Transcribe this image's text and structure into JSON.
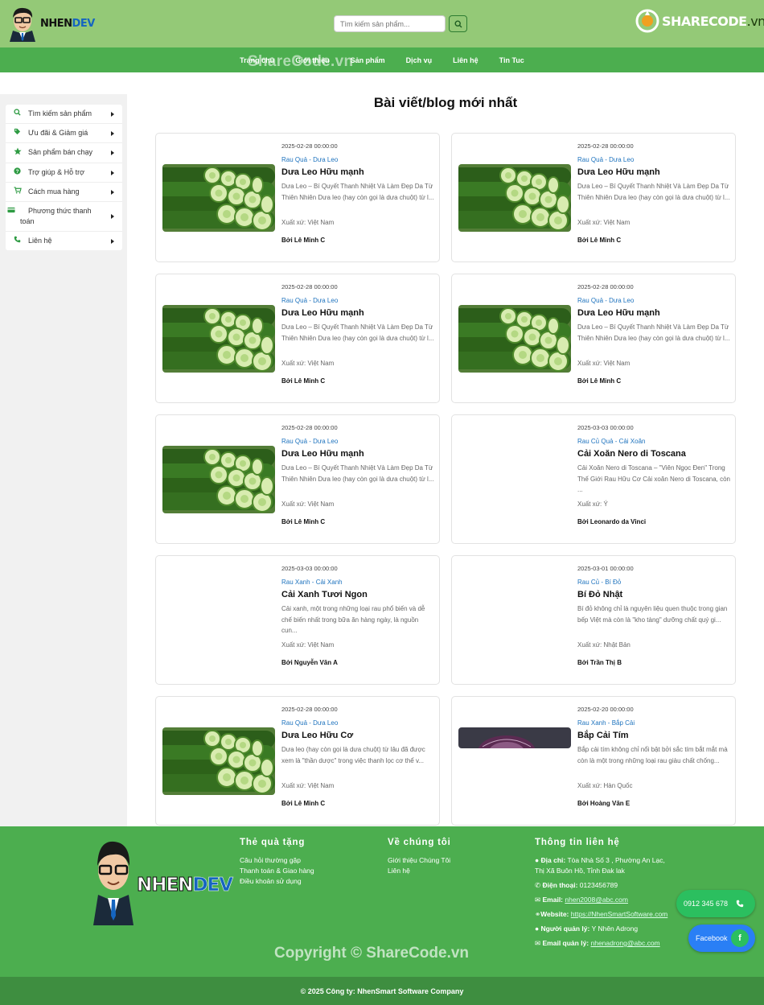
{
  "header": {
    "logo_text_a": "NHEN",
    "logo_text_b": "DEV",
    "search_placeholder": "Tìm kiếm sản phẩm...",
    "sharecode_main": "SHARECODE",
    "sharecode_domain": ".vn"
  },
  "nav": {
    "items": [
      "Trang chủ",
      "Giới thiệu",
      "Sản phẩm",
      "Dịch vụ",
      "Liên hệ",
      "Tin Tuc"
    ],
    "watermark": "ShareCode.vn"
  },
  "sidebar": {
    "items": [
      {
        "label": "Tìm kiếm sản phẩm",
        "icon": "search-icon"
      },
      {
        "label": "Ưu đãi & Giảm giá",
        "icon": "tag-icon"
      },
      {
        "label": "Sản phẩm bán chạy",
        "icon": "star-icon"
      },
      {
        "label": "Trợ giúp & Hỗ trợ",
        "icon": "question-icon"
      },
      {
        "label": "Cách mua hàng",
        "icon": "cart-icon"
      },
      {
        "label": "Phương thức thanh toán",
        "icon": "credit-card-icon"
      },
      {
        "label": "Liên hệ",
        "icon": "phone-icon"
      }
    ]
  },
  "main": {
    "title": "Bài viết/blog mới nhất",
    "posts": [
      {
        "date": "2025-02-28 00:00:00",
        "category": "Rau Quả - Dưa Leo",
        "title": "Dưa Leo Hữu mạnh",
        "desc": "Dưa Leo – Bí Quyết Thanh Nhiệt Và Làm Đẹp Da Từ Thiên Nhiên Dưa leo (hay còn gọi là dưa chuột) từ l...",
        "origin": "Xuất xứ: Việt Nam",
        "author": "Bởi Lê Minh C",
        "image": "cucumber"
      },
      {
        "date": "2025-02-28 00:00:00",
        "category": "Rau Quả - Dưa Leo",
        "title": "Dưa Leo Hữu mạnh",
        "desc": "Dưa Leo – Bí Quyết Thanh Nhiệt Và Làm Đẹp Da Từ Thiên Nhiên Dưa leo (hay còn gọi là dưa chuột) từ l...",
        "origin": "Xuất xứ: Việt Nam",
        "author": "Bởi Lê Minh C",
        "image": "cucumber"
      },
      {
        "date": "2025-02-28 00:00:00",
        "category": "Rau Quả - Dưa Leo",
        "title": "Dưa Leo Hữu mạnh",
        "desc": "Dưa Leo – Bí Quyết Thanh Nhiệt Và Làm Đẹp Da Từ Thiên Nhiên Dưa leo (hay còn gọi là dưa chuột) từ l...",
        "origin": "Xuất xứ: Việt Nam",
        "author": "Bởi Lê Minh C",
        "image": "cucumber"
      },
      {
        "date": "2025-02-28 00:00:00",
        "category": "Rau Quả - Dưa Leo",
        "title": "Dưa Leo Hữu mạnh",
        "desc": "Dưa Leo – Bí Quyết Thanh Nhiệt Và Làm Đẹp Da Từ Thiên Nhiên Dưa leo (hay còn gọi là dưa chuột) từ l...",
        "origin": "Xuất xứ: Việt Nam",
        "author": "Bởi Lê Minh C",
        "image": "cucumber"
      },
      {
        "date": "2025-02-28 00:00:00",
        "category": "Rau Quả - Dưa Leo",
        "title": "Dưa Leo Hữu mạnh",
        "desc": "Dưa Leo – Bí Quyết Thanh Nhiệt Và Làm Đẹp Da Từ Thiên Nhiên Dưa leo (hay còn gọi là dưa chuột) từ l...",
        "origin": "Xuất xứ: Việt Nam",
        "author": "Bởi Lê Minh C",
        "image": "cucumber"
      },
      {
        "date": "2025-03-03 00:00:00",
        "category": "Rau Củ Quả - Cải Xoăn",
        "title": "Cải Xoăn Nero di Toscana",
        "desc": "Cải Xoăn Nero di Toscana – \"Viên Ngọc Đen\" Trong Thế Giới Rau Hữu Cơ Cải xoăn Nero di Toscana, còn ...",
        "origin": "Xuất xứ: Ý",
        "author": "Bởi Leonardo da Vinci",
        "image": "none"
      },
      {
        "date": "2025-03-03 00:00:00",
        "category": "Rau Xanh - Cải Xanh",
        "title": "Cải Xanh Tươi Ngon",
        "desc": "Cải xanh, một trong những loại rau phổ biến và dễ chế biến nhất trong bữa ăn hàng ngày, là nguồn cun...",
        "origin": "Xuất xứ: Việt Nam",
        "author": "Bởi Nguyễn Văn A",
        "image": "none"
      },
      {
        "date": "2025-03-01 00:00:00",
        "category": "Rau Củ - Bí Đỏ",
        "title": "Bí Đỏ Nhật",
        "desc": "Bí đỏ không chỉ là nguyên liệu quen thuộc trong gian bếp Việt mà còn là \"kho tàng\" dưỡng chất quý gi...",
        "origin": "Xuất xứ: Nhật Bản",
        "author": "Bởi Trần Thị B",
        "image": "none"
      },
      {
        "date": "2025-02-28 00:00:00",
        "category": "Rau Quả - Dưa Leo",
        "title": "Dưa Leo Hữu Cơ",
        "desc": "Dưa leo (hay còn gọi là dưa chuột) từ lâu đã được xem là \"thần dược\" trong việc thanh lọc cơ thể v...",
        "origin": "Xuất xứ: Việt Nam",
        "author": "Bởi Lê Minh C",
        "image": "cucumber"
      },
      {
        "date": "2025-02-20 00:00:00",
        "category": "Rau Xanh - Bắp Cải",
        "title": "Bắp Cải Tím",
        "desc": "Bắp cải tím không chỉ nổi bật bởi sắc tím bắt mắt mà còn là một trong những loại rau giàu chất chống...",
        "origin": "Xuất xứ: Hàn Quốc",
        "author": "Bởi Hoàng Văn E",
        "image": "cabbage"
      }
    ]
  },
  "footer": {
    "logo_text_a": "NHEN",
    "logo_text_b": "DEV",
    "col1": {
      "title": "Thẻ quà tặng",
      "links": [
        "Câu hỏi thường gặp",
        "Thanh toán & Giao hàng",
        "Điều khoản sử dụng"
      ]
    },
    "col2": {
      "title": "Về chúng tôi",
      "links": [
        "Giới thiệu Chúng Tôi",
        "Liên hệ"
      ]
    },
    "col3": {
      "title": "Thông tin liên hệ",
      "address_label": "Địa chỉ:",
      "address": "Tòa Nhà Số 3 , Phường An Lạc, Thị Xã Buôn Hồ, Tỉnh Đak lak",
      "phone_label": "Điện thoại:",
      "phone": "0123456789",
      "email_label": "Email:",
      "email": "nhen2008@abc.com",
      "website_label": "Website:",
      "website": "https://NhenSmartSoftware.com",
      "manager_label": "Người quản lý:",
      "manager": "Y Nhên Adrong",
      "manager_email_label": "Email quản lý:",
      "manager_email": "nhenadrong@abc.com"
    },
    "copyright_watermark": "Copyright © ShareCode.vn",
    "bottom": "© 2025 Công ty: NhenSmart Software Company"
  },
  "floating": {
    "phone": "0912 345 678",
    "facebook": "Facebook",
    "facebook_glyph": "f"
  },
  "colors": {
    "header_bg": "#94c977",
    "nav_bg": "#4cae4f",
    "footer_bg": "#4cae4f",
    "accent_link": "#1e73be"
  }
}
